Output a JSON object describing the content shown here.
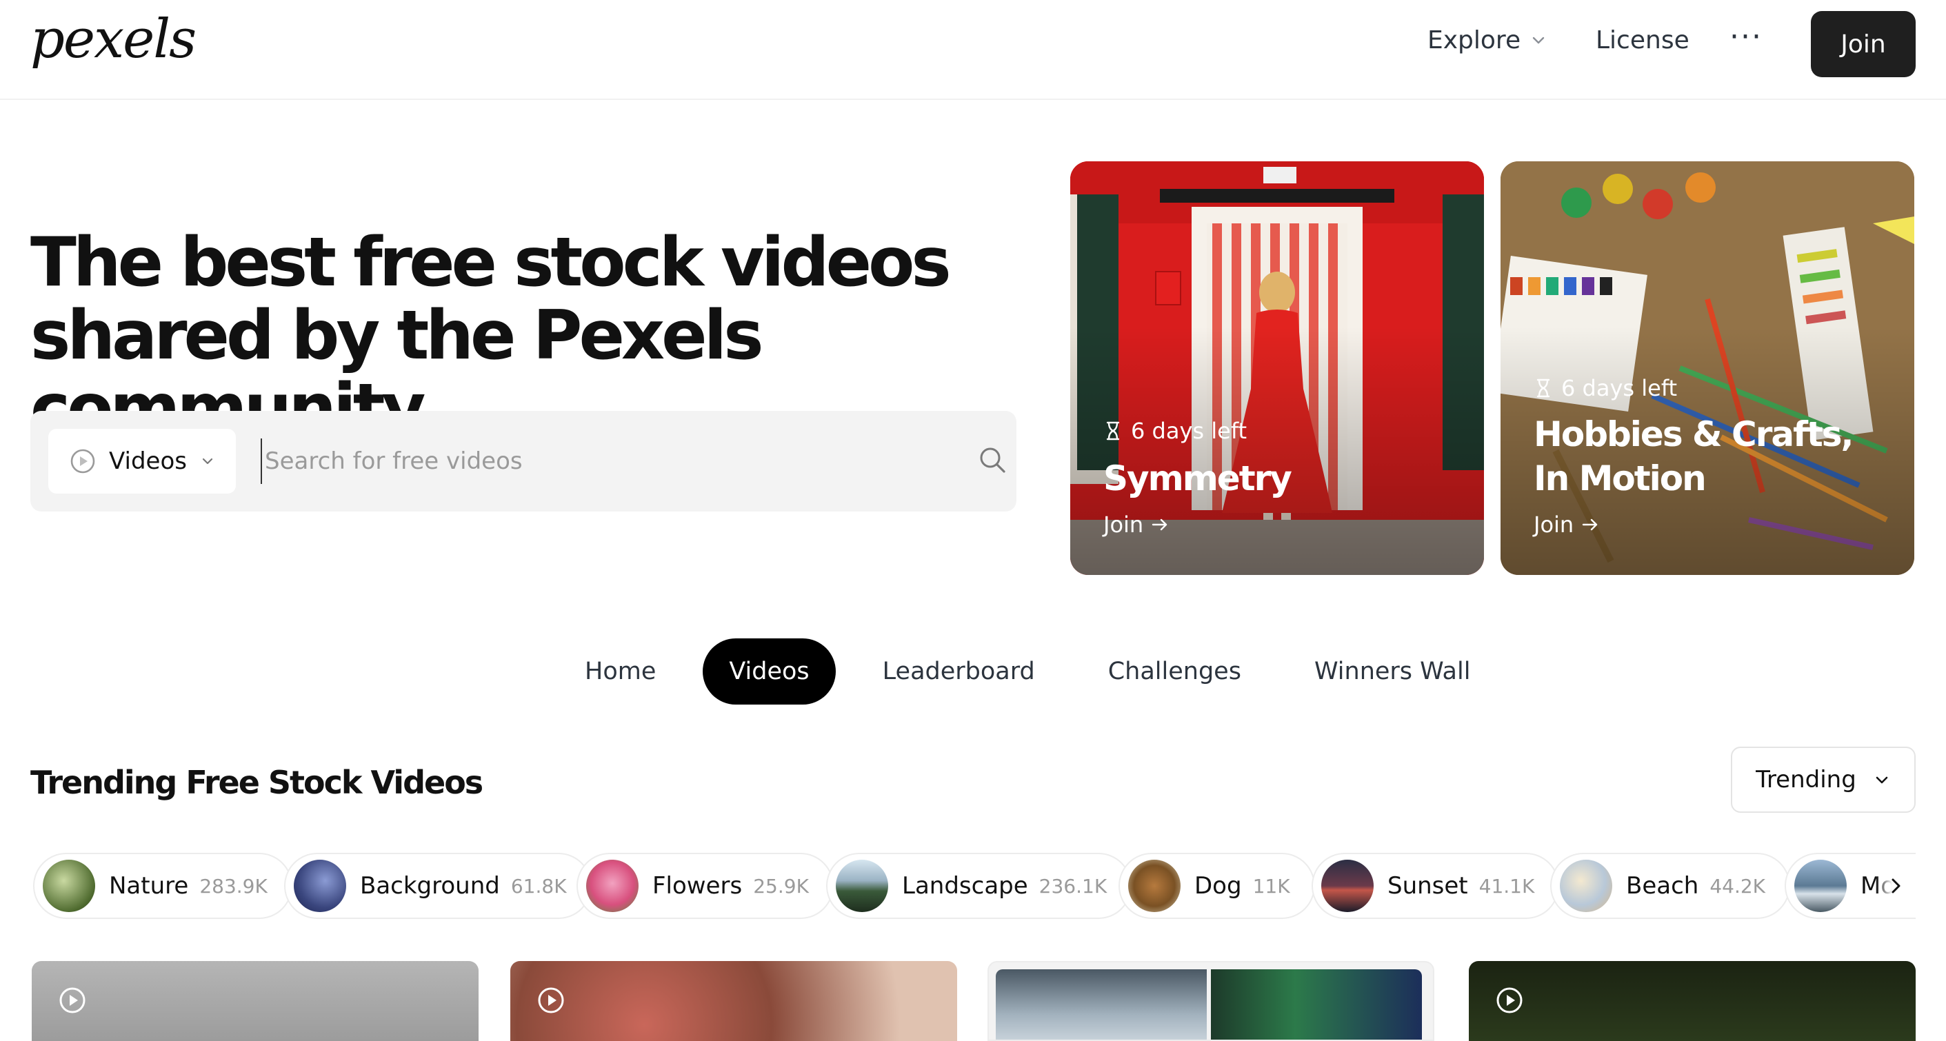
{
  "header": {
    "logo": "pexels",
    "nav": {
      "explore": "Explore",
      "license": "License",
      "more": "···"
    },
    "join_label": "Join"
  },
  "hero": {
    "title_line1": "The best free stock videos",
    "title_line2": "shared by the Pexels community.",
    "search": {
      "type_label": "Videos",
      "placeholder": "Search for free videos"
    }
  },
  "challenges": [
    {
      "days_left": "6 days left",
      "title": "Symmetry",
      "cta": "Join"
    },
    {
      "days_left": "6 days left",
      "title": "Hobbies & Crafts, In Motion",
      "cta": "Join"
    }
  ],
  "tabs": [
    {
      "label": "Home",
      "active": false
    },
    {
      "label": "Videos",
      "active": true
    },
    {
      "label": "Leaderboard",
      "active": false
    },
    {
      "label": "Challenges",
      "active": false
    },
    {
      "label": "Winners Wall",
      "active": false
    }
  ],
  "trending": {
    "title": "Trending Free Stock Videos",
    "sort_label": "Trending"
  },
  "categories": [
    {
      "name": "Nature",
      "count": "283.9K"
    },
    {
      "name": "Background",
      "count": "61.8K"
    },
    {
      "name": "Flowers",
      "count": "25.9K"
    },
    {
      "name": "Landscape",
      "count": "236.1K"
    },
    {
      "name": "Dog",
      "count": "11K"
    },
    {
      "name": "Sunset",
      "count": "41.1K"
    },
    {
      "name": "Beach",
      "count": "44.2K"
    },
    {
      "name": "Mo",
      "count": ""
    }
  ],
  "colors": {
    "accent_dark": "#1f1f1f",
    "search_bg": "#f3f3f3",
    "card1": "#d91d1d",
    "card2": "#9b7a4d"
  }
}
